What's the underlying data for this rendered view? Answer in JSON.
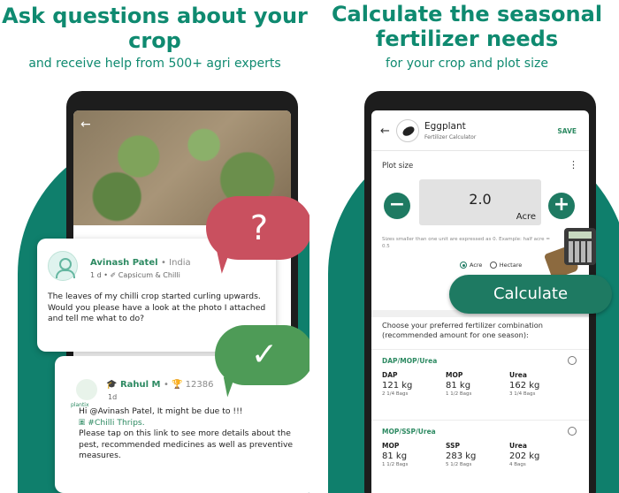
{
  "left": {
    "title": "Ask questions about your crop",
    "subtitle": "and receive help from 500+ agri experts",
    "question_bubble": "?",
    "check_bubble": "✓",
    "post": {
      "author": "Avinash Patel",
      "location": "• India",
      "meta": "1 d • ✐ Capsicum & Chilli",
      "text": "The leaves of my chilli crop started curling upwards. Would you please have a look at the photo I attached and tell me what to do?"
    },
    "reply": {
      "logo_text": "plantix",
      "author": "Rahul M",
      "points": "• 🏆 12386",
      "age": "1d",
      "mention": "@Avinash Patel",
      "line1": "Hi @Avinash Patel, It might be due to !!!",
      "tag": "🞖 #Chilli Thrips.",
      "text": "Please tap on this link to see more details about the pest, recommended medicines as well as preventive measures."
    }
  },
  "right": {
    "title": "Calculate the seasonal fertilizer needs",
    "subtitle": "for your crop and plot size",
    "appbar": {
      "crop": "Eggplant",
      "subtitle": "Fertilizer Calculator",
      "save": "SAVE"
    },
    "plot_label": "Plot size",
    "minus": "−",
    "plus": "+",
    "plot_value": "2.0",
    "plot_unit": "Acre",
    "hint": "Sizes smaller than one unit are expressed as 0. Example: half acre = 0.5",
    "unit_acre": "Acre",
    "unit_hectare": "Hectare",
    "calculate": "Calculate",
    "choose": "Choose your preferred fertilizer combination (recommended amount for one season):",
    "combos": [
      {
        "title": "DAP/MOP/Urea",
        "items": [
          {
            "label": "DAP",
            "value": "121 kg",
            "bags": "2 1/4 Bags"
          },
          {
            "label": "MOP",
            "value": "81 kg",
            "bags": "1 1/2 Bags"
          },
          {
            "label": "Urea",
            "value": "162 kg",
            "bags": "3 1/4 Bags"
          }
        ]
      },
      {
        "title": "MOP/SSP/Urea",
        "items": [
          {
            "label": "MOP",
            "value": "81 kg",
            "bags": "1 1/2 Bags"
          },
          {
            "label": "SSP",
            "value": "283 kg",
            "bags": "5 1/2 Bags"
          },
          {
            "label": "Urea",
            "value": "202 kg",
            "bags": "4 Bags"
          }
        ]
      }
    ]
  },
  "colors": {
    "brand": "#0f8a70",
    "teal_bg": "#0f7f6c",
    "question_bubble": "#c9505f",
    "check_bubble": "#4e9b57",
    "button": "#1e7a62"
  }
}
